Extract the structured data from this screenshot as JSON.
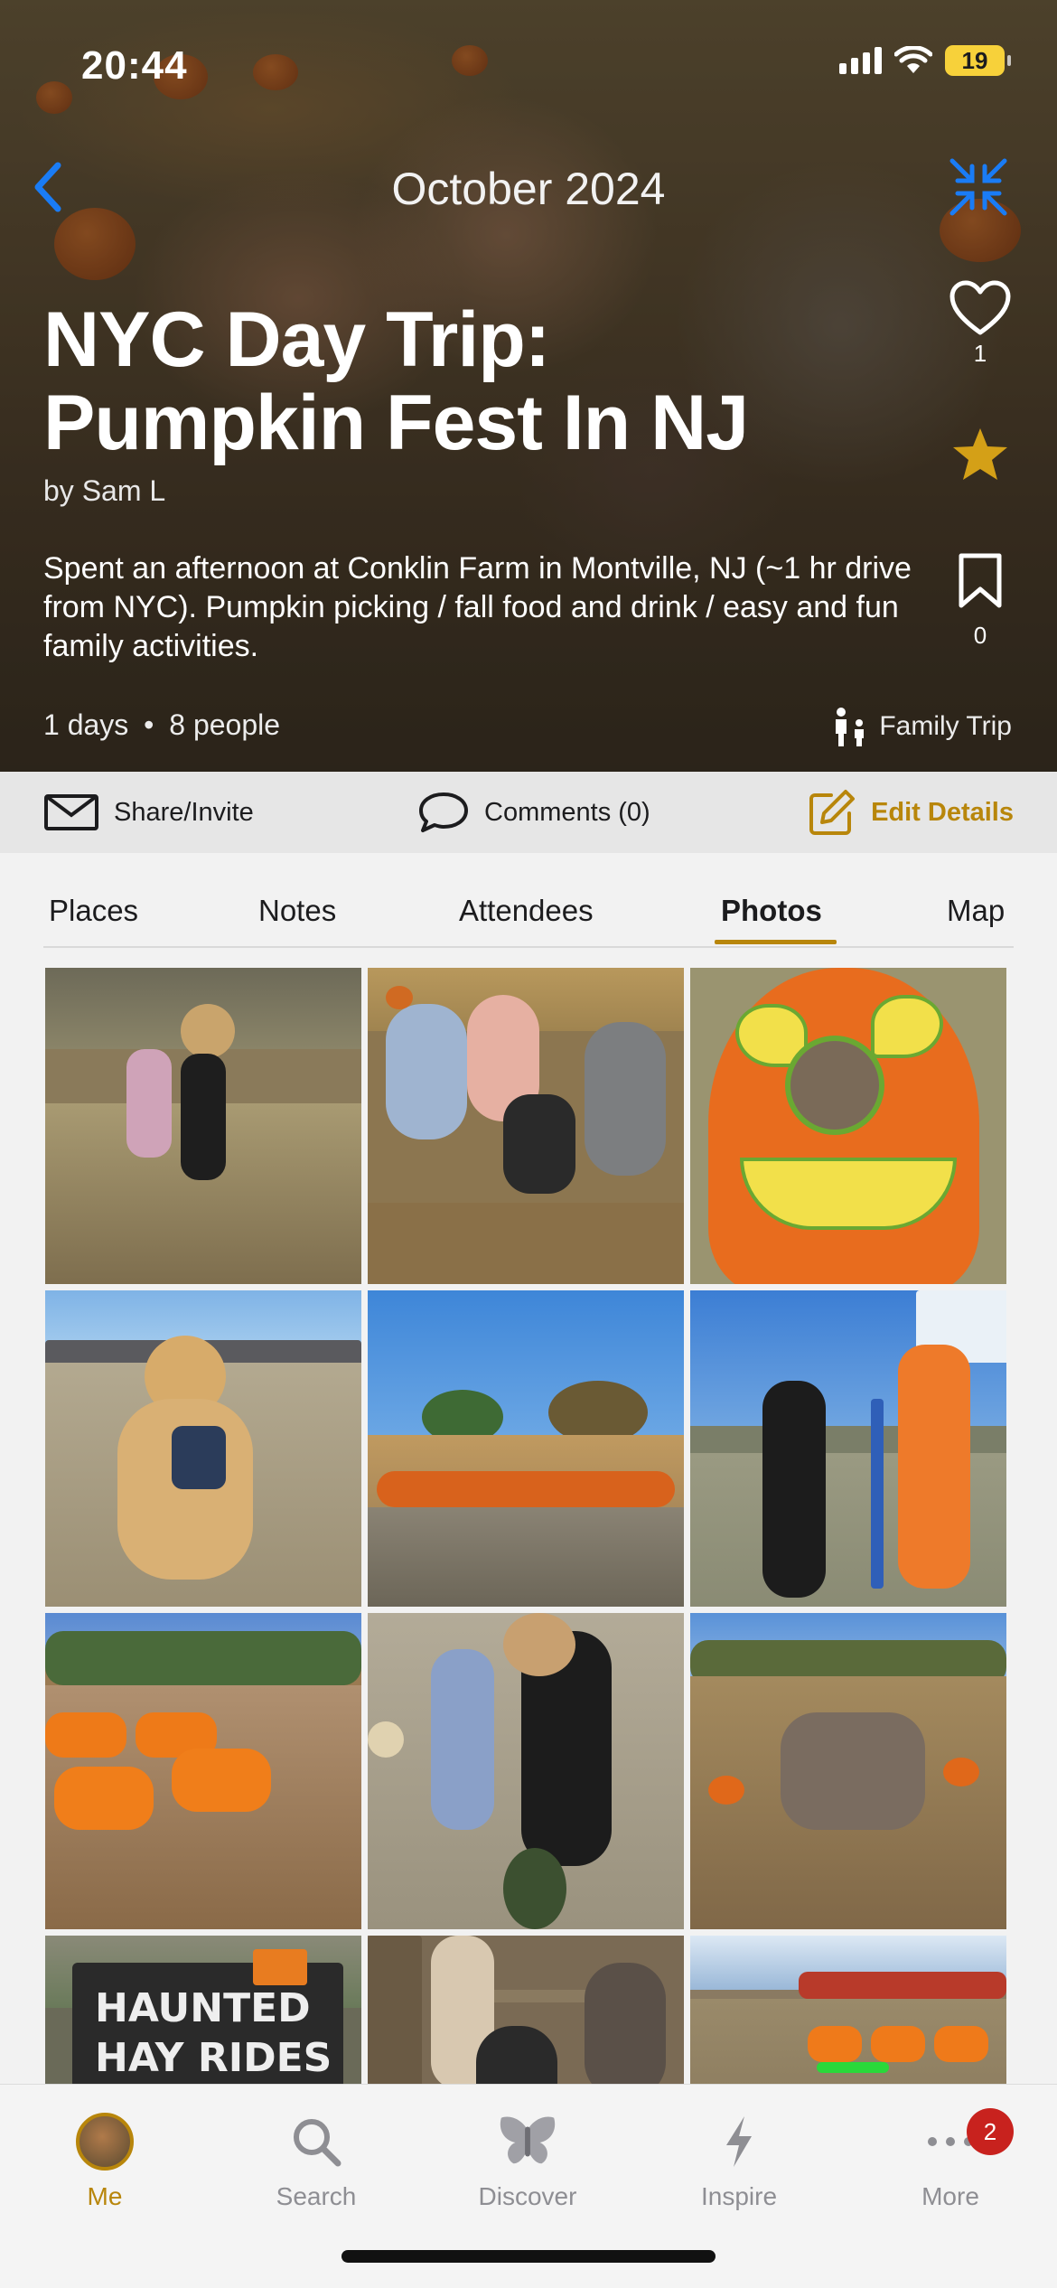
{
  "status_bar": {
    "time": "20:44",
    "battery": "19"
  },
  "header": {
    "title": "October 2024"
  },
  "trip": {
    "title_line1": "NYC Day Trip:",
    "title_line2": "Pumpkin Fest In NJ",
    "author": "by Sam L",
    "description": "Spent an afternoon at Conklin Farm in Montville, NJ (~1 hr drive from NYC). Pumpkin picking / fall food and drink / easy and fun family activities.",
    "days": "1 days",
    "people": "8 people",
    "meta_separator": "•",
    "type": "Family Trip",
    "likes": "1",
    "saves": "0"
  },
  "actions": {
    "share": "Share/Invite",
    "comments": "Comments (0)",
    "edit": "Edit Details"
  },
  "tabs": [
    {
      "label": "Places",
      "active": false
    },
    {
      "label": "Notes",
      "active": false
    },
    {
      "label": "Attendees",
      "active": false
    },
    {
      "label": "Photos",
      "active": true
    },
    {
      "label": "Map",
      "active": false
    }
  ],
  "photos": [
    "kids-at-petting-zoo",
    "family-group-photo",
    "child-in-jack-o-lantern-cutout",
    "golden-retriever",
    "pumpkin-field",
    "kids-at-vendor-tent",
    "barrel-train-ride",
    "kids-playing",
    "group-in-pumpkin-patch",
    "haunted-hay-rides-sign",
    "family-by-fence",
    "barrel-train-ride-2"
  ],
  "photo_text": {
    "sign_line1": "HAUNTED",
    "sign_line2": "HAY RIDES"
  },
  "bottom_nav": [
    {
      "label": "Me",
      "icon": "avatar",
      "active": true
    },
    {
      "label": "Search",
      "icon": "search-icon",
      "active": false
    },
    {
      "label": "Discover",
      "icon": "butterfly-icon",
      "active": false
    },
    {
      "label": "Inspire",
      "icon": "bolt-icon",
      "active": false
    },
    {
      "label": "More",
      "icon": "ellipsis-icon",
      "active": false,
      "badge": "2"
    }
  ],
  "colors": {
    "accent": "#b8860b",
    "link_blue": "#1a7cf5",
    "badge_red": "#c8221e",
    "star": "#d4a017"
  }
}
